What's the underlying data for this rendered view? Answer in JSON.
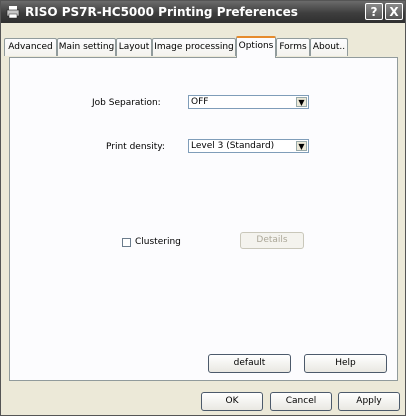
{
  "window": {
    "title": "RISO PS7R-HC5000 Printing Preferences",
    "help_glyph": "?",
    "close_glyph": "X",
    "icon": "printer-icon"
  },
  "tabs": [
    {
      "label": "Advanced",
      "active": false
    },
    {
      "label": "Main setting",
      "active": false
    },
    {
      "label": "Layout",
      "active": false
    },
    {
      "label": "Image processing",
      "active": false
    },
    {
      "label": "Options",
      "active": true
    },
    {
      "label": "Forms",
      "active": false
    },
    {
      "label": "About..",
      "active": false
    }
  ],
  "options": {
    "job_separation": {
      "label": "Job Separation:",
      "value": "OFF"
    },
    "print_density": {
      "label": "Print density:",
      "value": "Level 3 (Standard)"
    },
    "clustering": {
      "label": "Clustering",
      "checked": false
    },
    "details_label": "Details",
    "default_label": "default",
    "help_label": "Help"
  },
  "footer": {
    "ok_label": "OK",
    "cancel_label": "Cancel",
    "apply_label": "Apply"
  },
  "colors": {
    "titlebar": "#3e3e3e",
    "active_tab_highlight": "#e68b2c",
    "dialog_bg": "#ece9d8"
  }
}
